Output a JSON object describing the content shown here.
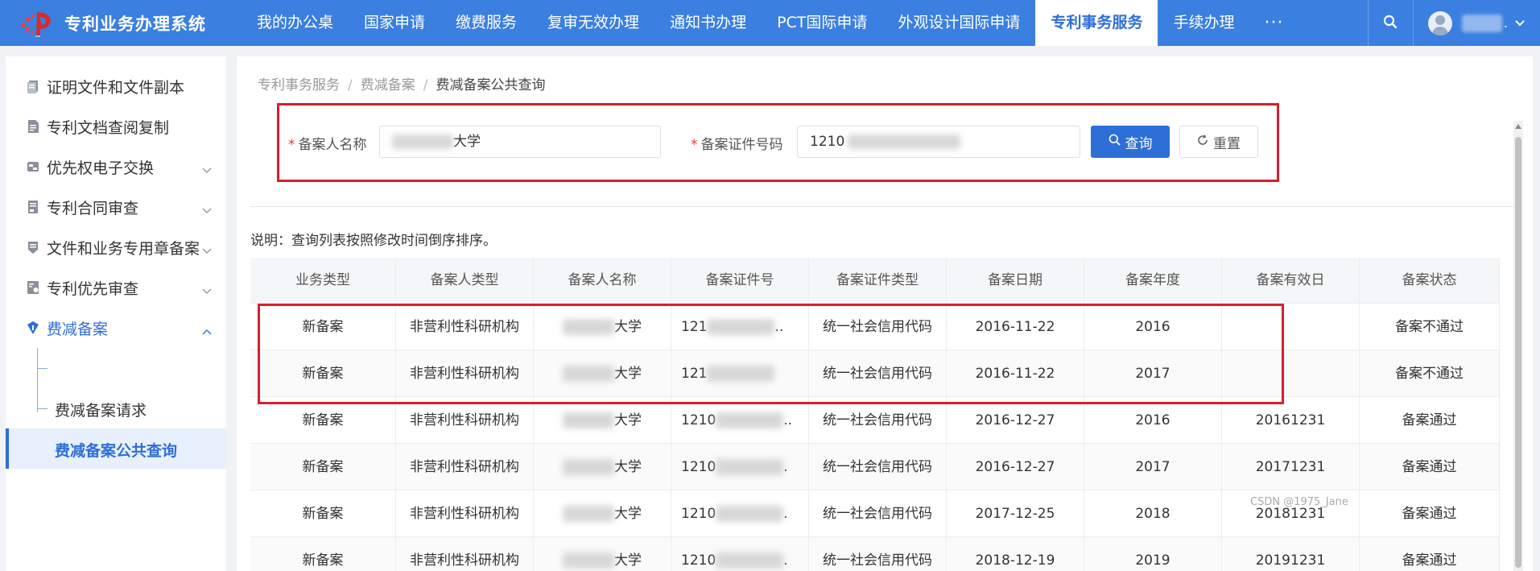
{
  "app": {
    "title": "专利业务办理系统"
  },
  "nav": {
    "items": [
      {
        "label": "我的办公桌",
        "active": false
      },
      {
        "label": "国家申请",
        "active": false
      },
      {
        "label": "缴费服务",
        "active": false
      },
      {
        "label": "复审无效办理",
        "active": false
      },
      {
        "label": "通知书办理",
        "active": false
      },
      {
        "label": "PCT国际申请",
        "active": false
      },
      {
        "label": "外观设计国际申请",
        "active": false
      },
      {
        "label": "专利事务服务",
        "active": true
      },
      {
        "label": "手续办理",
        "active": false
      }
    ],
    "more": "···"
  },
  "user": {
    "name_suffix": "."
  },
  "sidebar": {
    "items": [
      {
        "label": "证明文件和文件副本",
        "icon": "certificate-icon",
        "has_arrow": false
      },
      {
        "label": "专利文档查阅复制",
        "icon": "document-icon",
        "has_arrow": false
      },
      {
        "label": "优先权电子交换",
        "icon": "exchange-icon",
        "has_arrow": true
      },
      {
        "label": "专利合同审查",
        "icon": "contract-icon",
        "has_arrow": true
      },
      {
        "label": "文件和业务专用章备案",
        "icon": "seal-icon",
        "has_arrow": true
      },
      {
        "label": "专利优先审查",
        "icon": "priority-icon",
        "has_arrow": true
      },
      {
        "label": "费减备案",
        "icon": "fee-reduction-icon",
        "has_arrow": true,
        "expanded": true
      }
    ],
    "subitems": [
      {
        "label": "费减备案请求",
        "active": false
      },
      {
        "label": "费减备案公共查询",
        "active": true
      }
    ]
  },
  "breadcrumb": {
    "items": [
      "专利事务服务",
      "费减备案",
      "费减备案公共查询"
    ],
    "separator": "/"
  },
  "search": {
    "name_label": "备案人名称",
    "name_value_visible": "大学",
    "id_label": "备案证件号码",
    "id_value_visible": "1210",
    "required_mark": "*",
    "query_button": "查询",
    "reset_button": "重置"
  },
  "note": "说明：查询列表按照修改时间倒序排序。",
  "table": {
    "headers": [
      "业务类型",
      "备案人类型",
      "备案人名称",
      "备案证件号",
      "备案证件类型",
      "备案日期",
      "备案年度",
      "备案有效日",
      "备案状态"
    ],
    "rows": [
      {
        "type": "新备案",
        "applicant_type": "非营利性科研机构",
        "name_suffix": "大学",
        "id_prefix": "121",
        "id_suffix": "..",
        "id_type": "统一社会信用代码",
        "date": "2016-11-22",
        "year": "2016",
        "valid_date": "",
        "status": "备案不通过"
      },
      {
        "type": "新备案",
        "applicant_type": "非营利性科研机构",
        "name_suffix": "大学",
        "id_prefix": "121",
        "id_suffix": "",
        "id_type": "统一社会信用代码",
        "date": "2016-11-22",
        "year": "2017",
        "valid_date": "",
        "status": "备案不通过"
      },
      {
        "type": "新备案",
        "applicant_type": "非营利性科研机构",
        "name_suffix": "大学",
        "id_prefix": "1210",
        "id_suffix": "..",
        "id_type": "统一社会信用代码",
        "date": "2016-12-27",
        "year": "2016",
        "valid_date": "20161231",
        "status": "备案通过"
      },
      {
        "type": "新备案",
        "applicant_type": "非营利性科研机构",
        "name_suffix": "大学",
        "id_prefix": "1210",
        "id_suffix": ".",
        "id_type": "统一社会信用代码",
        "date": "2016-12-27",
        "year": "2017",
        "valid_date": "20171231",
        "status": "备案通过"
      },
      {
        "type": "新备案",
        "applicant_type": "非营利性科研机构",
        "name_suffix": "大学",
        "id_prefix": "1210",
        "id_suffix": ".",
        "id_type": "统一社会信用代码",
        "date": "2017-12-25",
        "year": "2018",
        "valid_date": "20181231",
        "status": "备案通过"
      },
      {
        "type": "新备案",
        "applicant_type": "非营利性科研机构",
        "name_suffix": "大学",
        "id_prefix": "1210",
        "id_suffix": ".",
        "id_type": "统一社会信用代码",
        "date": "2018-12-19",
        "year": "2019",
        "valid_date": "20191231",
        "status": "备案通过"
      }
    ]
  },
  "watermark": "CSDN @1975_Jane",
  "colors": {
    "primary": "#2d6fd6",
    "topbar": "#3b7fe0",
    "annotation_red": "#d7202e"
  }
}
